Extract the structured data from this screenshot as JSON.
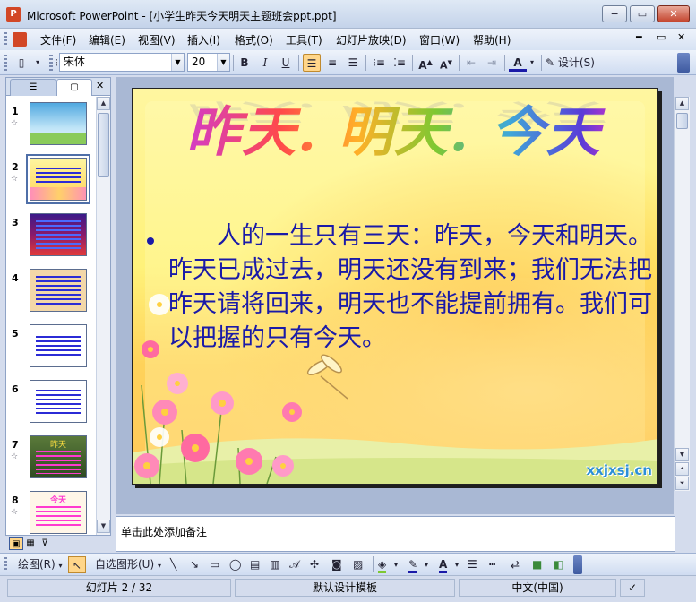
{
  "window": {
    "icon": "powerpoint-icon",
    "title": "Microsoft PowerPoint - [小学生昨天今天明天主题班会ppt.ppt]",
    "buttons": {
      "minimize": "━",
      "maximize": "▭",
      "close": "✕"
    }
  },
  "menu": {
    "items": [
      "文件(F)",
      "编辑(E)",
      "视图(V)",
      "插入(I)",
      "格式(O)",
      "工具(T)",
      "幻灯片放映(D)",
      "窗口(W)",
      "帮助(H)"
    ],
    "window_controls": {
      "minimize": "━",
      "restore": "▭",
      "close": "✕"
    }
  },
  "toolbar": {
    "font_name": "宋体",
    "font_size": "20",
    "bold": "B",
    "italic": "I",
    "underline": "U",
    "align_left_icon": "≡",
    "design_label": "设计(S)"
  },
  "left_panel": {
    "tabs": [
      "outline-tab",
      "slides-tab"
    ],
    "close": "✕",
    "slides": [
      {
        "num": "1",
        "star": "☆",
        "bg": "#7ec4ec",
        "selected": false
      },
      {
        "num": "2",
        "star": "☆",
        "bg": "#fff27a",
        "selected": true
      },
      {
        "num": "3",
        "star": "",
        "bg": "#8a1a6a",
        "selected": false
      },
      {
        "num": "4",
        "star": "",
        "bg": "#f3d7a8",
        "selected": false
      },
      {
        "num": "5",
        "star": "",
        "bg": "#ffffff",
        "selected": false
      },
      {
        "num": "6",
        "star": "",
        "bg": "#ffffff",
        "selected": false
      },
      {
        "num": "7",
        "star": "☆",
        "bg": "#5a7a3a",
        "selected": false
      },
      {
        "num": "8",
        "star": "☆",
        "bg": "#fff6e8",
        "selected": false
      }
    ],
    "thumb_titles": {
      "7": "昨天",
      "8": "今天"
    }
  },
  "slide": {
    "wordart": "昨天. 明天. 今天",
    "body": "人的一生只有三天：昨天，今天和明天。昨天已成过去，明天还没有到来；我们无法把昨天请将回来，明天也不能提前拥有。我们可以把握的只有今天。",
    "watermark": "xxjxsj.cn"
  },
  "notes": {
    "placeholder": "单击此处添加备注"
  },
  "draw_toolbar": {
    "draw_label": "绘图(R)",
    "autoshapes_label": "自选图形(U)"
  },
  "status": {
    "slide_info": "幻灯片 2 / 32",
    "template": "默认设计模板",
    "language": "中文(中国)"
  }
}
